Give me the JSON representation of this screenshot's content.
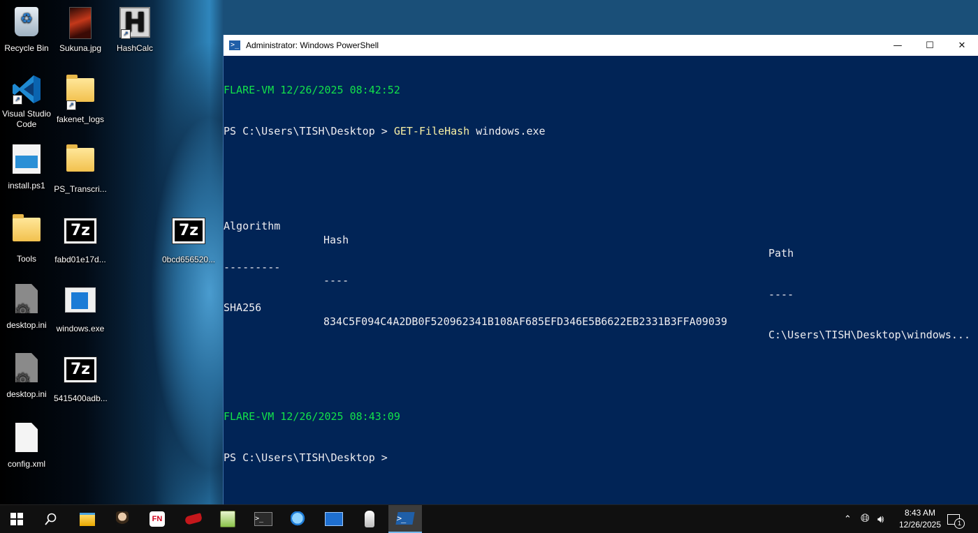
{
  "desktop": {
    "icons": [
      {
        "label": "Recycle Bin",
        "icon": "recycle-bin-icon"
      },
      {
        "label": "Sukuna.jpg",
        "icon": "image-file-icon"
      },
      {
        "label": "HashCalc",
        "icon": "hashcalc-icon"
      },
      {
        "label": "Visual Studio",
        "label2": "Code",
        "icon": "vscode-icon"
      },
      {
        "label": "fakenet_logs",
        "icon": "folder-icon"
      },
      {
        "label": "install.ps1",
        "icon": "powershell-script-icon"
      },
      {
        "label": "PS_Transcri...",
        "icon": "folder-icon"
      },
      {
        "label": "Tools",
        "icon": "folder-icon"
      },
      {
        "label": "fabd01e17d...",
        "icon": "7zip-archive-icon"
      },
      {
        "label": "0bcd656520...",
        "icon": "7zip-archive-icon"
      },
      {
        "label": "desktop.ini",
        "icon": "settings-file-icon"
      },
      {
        "label": "windows.exe",
        "icon": "exe-file-icon"
      },
      {
        "label": "desktop.ini",
        "icon": "settings-file-icon"
      },
      {
        "label": "5415400adb...",
        "icon": "7zip-archive-icon"
      },
      {
        "label": "config.xml",
        "icon": "file-icon"
      }
    ]
  },
  "window": {
    "title": "Administrator: Windows PowerShell",
    "minimize_glyph": "—",
    "maximize_glyph": "☐",
    "close_glyph": "✕"
  },
  "console": {
    "prompt1_banner": "FLARE-VM 12/26/2025 08:42:52",
    "prompt1_path": "PS C:\\Users\\TISH\\Desktop > ",
    "prompt1_cmd": "GET-FileHash",
    "prompt1_arg": " windows.exe",
    "headers": {
      "algorithm": "Algorithm",
      "hash": "Hash",
      "path": "Path"
    },
    "separators": {
      "algorithm": "---------",
      "hash": "----",
      "path": "----"
    },
    "row": {
      "algorithm": "SHA256",
      "hash": "834C5F094C4A2DB0F520962341B108AF685EFD346E5B6622EB2331B3FFA09039",
      "path": "C:\\Users\\TISH\\Desktop\\windows..."
    },
    "prompt2_banner": "FLARE-VM 12/26/2025 08:43:09",
    "prompt2_path": "PS C:\\Users\\TISH\\Desktop > "
  },
  "colors": {
    "console_bg": "#012456",
    "banner_green": "#13e24a",
    "command_yellow": "#f9f1a5",
    "text": "#eeedf0"
  },
  "taskbar": {
    "start_icon": "windows-start-icon",
    "items": [
      "search-icon",
      "file-explorer-icon",
      "gimp-icon",
      "fakenet-icon",
      "chili-icon",
      "notepad-plus-plus-icon",
      "terminal-icon",
      "magnifier-icon",
      "process-monitor-icon",
      "ghidra-icon",
      "powershell-icon"
    ],
    "clock_time": "8:43 AM",
    "clock_date": "12/26/2025",
    "notification_count": "1"
  }
}
